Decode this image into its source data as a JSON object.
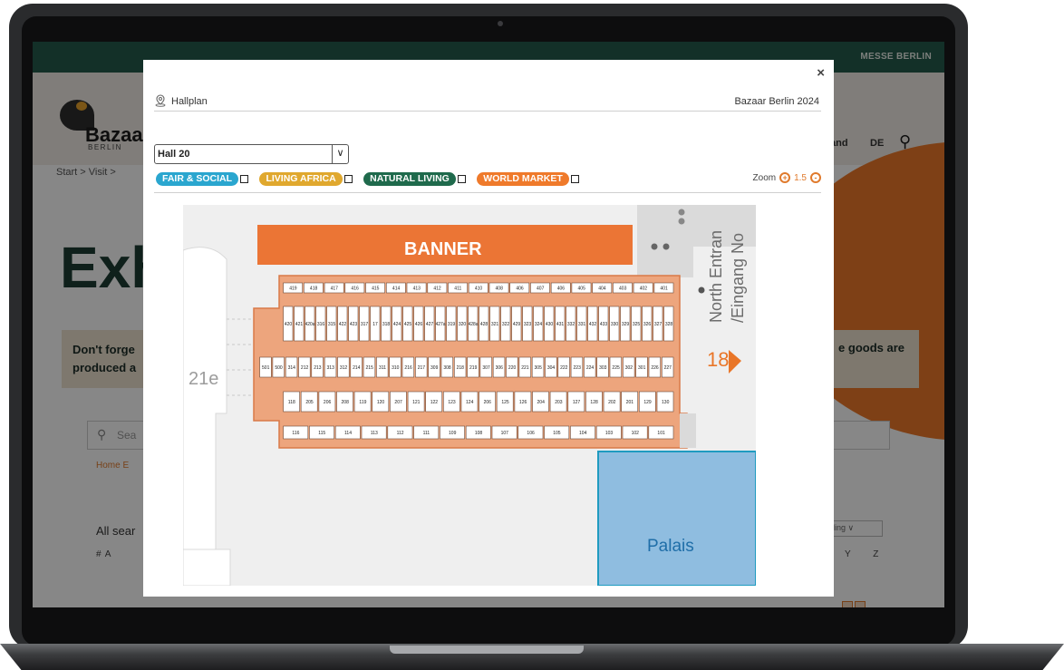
{
  "site": {
    "brand_top": "MESSE BERLIN",
    "logo": "Bazaar",
    "logo_sub": "BERLIN",
    "nav_partial": "and",
    "lang": "DE",
    "breadcrumb": "Start > Visit >",
    "hero": "Exh",
    "notice_left": "Don't forge produced a",
    "notice_right": "e goods are",
    "search_placeholder": "Sea",
    "crumb2": "Home  E",
    "all_search": "All sear",
    "sort_value": "nding",
    "alpha_left": "#  A",
    "alpha_right": "Y Z"
  },
  "modal": {
    "close": "×",
    "title": "Hallplan",
    "event": "Bazaar Berlin 2024",
    "hall_select": "Hall 20",
    "categories": [
      {
        "label": "FAIR & SOCIAL",
        "color": "#2aa6cf"
      },
      {
        "label": "LIVING AFRICA",
        "color": "#e0a82e"
      },
      {
        "label": "NATURAL LIVING",
        "color": "#1f6a4c"
      },
      {
        "label": "WORLD MARKET",
        "color": "#ef7a2b"
      }
    ],
    "zoom_label": "Zoom",
    "zoom_value": "1.5"
  },
  "plan": {
    "banner": "BANNER",
    "hall_left": "21e",
    "north_1": "North Entran",
    "north_2": "/Eingang No",
    "hall_right": "18",
    "palais": "Palais",
    "colors": {
      "booth_area": "#eda57d",
      "booth": "#ffffff",
      "banner": "#eb7535",
      "palais": "#8fbde0",
      "palais_border": "#1f9bc0",
      "arrow": "#e97628"
    },
    "rows": [
      [
        "419",
        "418",
        "417",
        "416",
        "415",
        "414",
        "413",
        "412",
        "411",
        "410",
        "408",
        "406",
        "407",
        "406",
        "405",
        "404",
        "403",
        "402",
        "401"
      ],
      [
        "420",
        "421",
        "420a",
        "316",
        "315",
        "422",
        "423",
        "317",
        "17",
        "318",
        "424",
        "425",
        "426",
        "427",
        "427a",
        "319",
        "320",
        "428a",
        "428",
        "321",
        "322",
        "429",
        "323",
        "324",
        "430",
        "431",
        "332",
        "331",
        "432",
        "433",
        "330",
        "329",
        "325",
        "326",
        "327",
        "328"
      ],
      [
        "501",
        "500",
        "314",
        "212",
        "213",
        "313",
        "312",
        "214",
        "215",
        "311",
        "310",
        "216",
        "217",
        "309",
        "308",
        "218",
        "219",
        "307",
        "306",
        "220",
        "221",
        "305",
        "304",
        "222",
        "223",
        "224",
        "303",
        "225",
        "302",
        "301",
        "226",
        "227"
      ],
      [
        "118",
        "205",
        "206",
        "208",
        "119",
        "120",
        "207",
        "121",
        "122",
        "123",
        "124",
        "206",
        "125",
        "126",
        "204",
        "203",
        "127",
        "128",
        "202",
        "201",
        "129",
        "130"
      ],
      [
        "116",
        "115",
        "114",
        "113",
        "112",
        "111",
        "109",
        "108",
        "107",
        "106",
        "105",
        "104",
        "103",
        "102",
        "101"
      ]
    ]
  }
}
